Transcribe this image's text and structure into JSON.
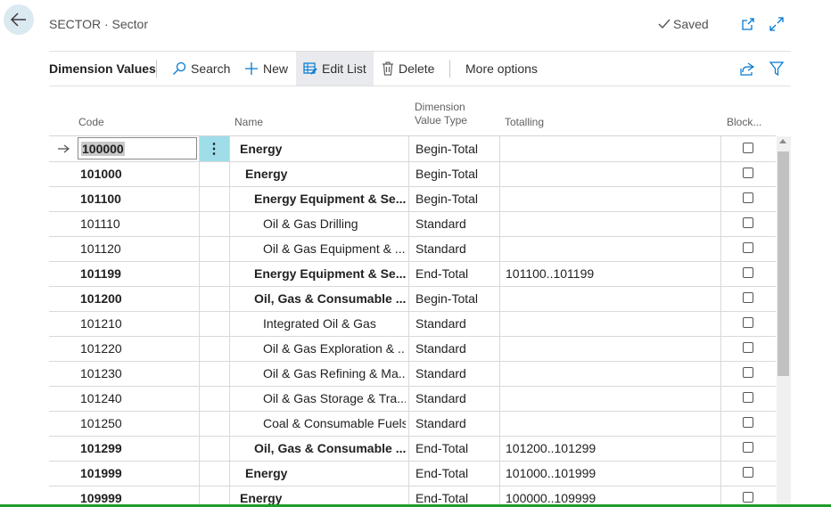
{
  "header": {
    "title": "SECTOR · Sector",
    "saved_label": "Saved"
  },
  "toolbar": {
    "title": "Dimension Values",
    "search_label": "Search",
    "new_label": "New",
    "edit_list_label": "Edit List",
    "delete_label": "Delete",
    "more_options_label": "More options"
  },
  "columns": {
    "code": "Code",
    "name": "Name",
    "type_line1": "Dimension",
    "type_line2": "Value Type",
    "totalling": "Totalling",
    "blocked": "Block..."
  },
  "rows": [
    {
      "code": "100000",
      "name": "Energy",
      "type": "Begin-Total",
      "totalling": "",
      "blocked": false,
      "bold": true,
      "indent": 0
    },
    {
      "code": "101000",
      "name": "Energy",
      "type": "Begin-Total",
      "totalling": "",
      "blocked": false,
      "bold": true,
      "indent": 1
    },
    {
      "code": "101100",
      "name": "Energy Equipment & Se...",
      "type": "Begin-Total",
      "totalling": "",
      "blocked": false,
      "bold": true,
      "indent": 2
    },
    {
      "code": "101110",
      "name": "Oil & Gas Drilling",
      "type": "Standard",
      "totalling": "",
      "blocked": false,
      "bold": false,
      "indent": 3
    },
    {
      "code": "101120",
      "name": "Oil & Gas Equipment & ...",
      "type": "Standard",
      "totalling": "",
      "blocked": false,
      "bold": false,
      "indent": 3
    },
    {
      "code": "101199",
      "name": "Energy Equipment & Se...",
      "type": "End-Total",
      "totalling": "101100..101199",
      "blocked": false,
      "bold": true,
      "indent": 2
    },
    {
      "code": "101200",
      "name": "Oil, Gas & Consumable ...",
      "type": "Begin-Total",
      "totalling": "",
      "blocked": false,
      "bold": true,
      "indent": 2
    },
    {
      "code": "101210",
      "name": "Integrated Oil & Gas",
      "type": "Standard",
      "totalling": "",
      "blocked": false,
      "bold": false,
      "indent": 3
    },
    {
      "code": "101220",
      "name": "Oil & Gas Exploration & ...",
      "type": "Standard",
      "totalling": "",
      "blocked": false,
      "bold": false,
      "indent": 3
    },
    {
      "code": "101230",
      "name": "Oil & Gas Refining & Ma...",
      "type": "Standard",
      "totalling": "",
      "blocked": false,
      "bold": false,
      "indent": 3
    },
    {
      "code": "101240",
      "name": "Oil & Gas Storage & Tra...",
      "type": "Standard",
      "totalling": "",
      "blocked": false,
      "bold": false,
      "indent": 3
    },
    {
      "code": "101250",
      "name": "Coal & Consumable Fuels",
      "type": "Standard",
      "totalling": "",
      "blocked": false,
      "bold": false,
      "indent": 3
    },
    {
      "code": "101299",
      "name": "Oil, Gas & Consumable ...",
      "type": "End-Total",
      "totalling": "101200..101299",
      "blocked": false,
      "bold": true,
      "indent": 2
    },
    {
      "code": "101999",
      "name": "Energy",
      "type": "End-Total",
      "totalling": "101000..101999",
      "blocked": false,
      "bold": true,
      "indent": 1
    },
    {
      "code": "109999",
      "name": "Energy",
      "type": "End-Total",
      "totalling": "100000..109999",
      "blocked": false,
      "bold": true,
      "indent": 0
    }
  ],
  "icons": {
    "back": "back-arrow-icon",
    "saved": "checkmark-icon",
    "open_new": "open-in-new-window-icon",
    "expand": "expand-icon",
    "search": "search-icon",
    "new": "plus-icon",
    "edit_list": "edit-list-icon",
    "delete": "trash-icon",
    "share": "share-icon",
    "filter": "filter-icon",
    "row_indicator": "row-arrow-icon",
    "row_menu": "row-menu-icon"
  },
  "colors": {
    "back_button_bg": "#dbe9f1",
    "row_menu_bg": "#9fdde9",
    "accent_blue": "#0078d4",
    "status_bar_green": "#1f9d2c"
  }
}
